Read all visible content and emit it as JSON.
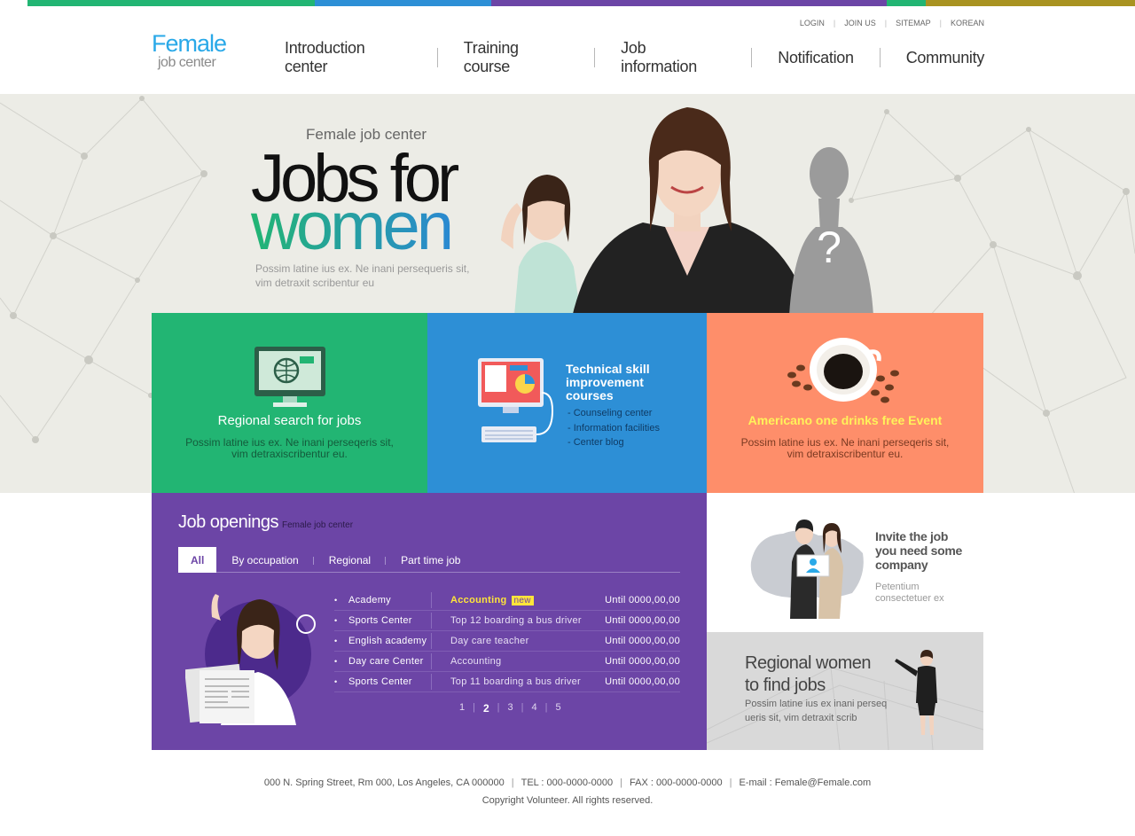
{
  "colors": {
    "topbar": [
      "#22b573",
      "#2d8fd6",
      "#6c45a6",
      "#22b573",
      "#a99321"
    ],
    "green": "#22b573",
    "blue": "#2d8fd6",
    "orange": "#fe8e6a",
    "purple": "#6c45a6",
    "logo_blue": "#2aa9e8",
    "highlight_yellow": "#ffe53a"
  },
  "logo": {
    "line1": "Female",
    "line2": "job center"
  },
  "util_links": [
    "LOGIN",
    "JOIN US",
    "SITEMAP",
    "KOREAN"
  ],
  "nav": [
    "Introduction center",
    "Training course",
    "Job information",
    "Notification",
    "Community"
  ],
  "hero": {
    "kicker": "Female job center",
    "headline1": "Jobs for",
    "headline2": "women",
    "description": "Possim latine ius ex. Ne inani persequeris sit, vim detraxit scribentur eu",
    "silhouette_mark": "?"
  },
  "features": [
    {
      "icon": "monitor-globe-icon",
      "title": "Regional search for jobs",
      "text1": "Possim latine ius ex. Ne inani perseqeris sit,",
      "text2": "vim detraxiscribentur eu."
    },
    {
      "icon": "computer-chart-icon",
      "title1": "Technical skill",
      "title2": "improvement",
      "title3": "courses",
      "links": [
        "Counseling center",
        "Information facilities",
        "Center blog"
      ]
    },
    {
      "icon": "coffee-cup-icon",
      "title": "Americano one drinks free Event",
      "text1": "Possim latine ius ex. Ne inani perseqeris sit,",
      "text2": "vim detraxiscribentur eu."
    }
  ],
  "jobs": {
    "title": "Job openings",
    "subtitle": "Female job center",
    "tabs": [
      "All",
      "By occupation",
      "Regional",
      "Part time job"
    ],
    "rows": [
      {
        "place": "Academy",
        "job": "Accounting",
        "badge": "new",
        "until": "Until 0000,00,00"
      },
      {
        "place": "Sports Center",
        "job": "Top 12 boarding a bus driver",
        "until": "Until 0000,00,00"
      },
      {
        "place": "English academy",
        "job": "Day care teacher",
        "until": "Until 0000,00,00"
      },
      {
        "place": "Day care Center",
        "job": "Accounting",
        "until": "Until 0000,00,00"
      },
      {
        "place": "Sports Center",
        "job": "Top 11 boarding a bus driver",
        "until": "Until 0000,00,00"
      }
    ],
    "pages": [
      "1",
      "2",
      "3",
      "4",
      "5"
    ],
    "current_page": "2"
  },
  "invite": {
    "line1": "Invite the job",
    "line2": "you need some",
    "line3": "company",
    "sub1": "Petentium",
    "sub2": "consectetuer ex"
  },
  "regional": {
    "line1": "Regional women",
    "line2": "to find jobs",
    "sub1": "Possim latine ius ex inani perseq",
    "sub2": "ueris sit, vim detraxit scrib"
  },
  "footer": {
    "address": "000 N. Spring Street, Rm 000, Los Angeles, CA 000000",
    "tel": "TEL : 000-0000-0000",
    "fax": "FAX : 000-0000-0000",
    "email": "E-mail : Female@Female.com",
    "copyright": "Copyright Volunteer. All rights reserved."
  }
}
